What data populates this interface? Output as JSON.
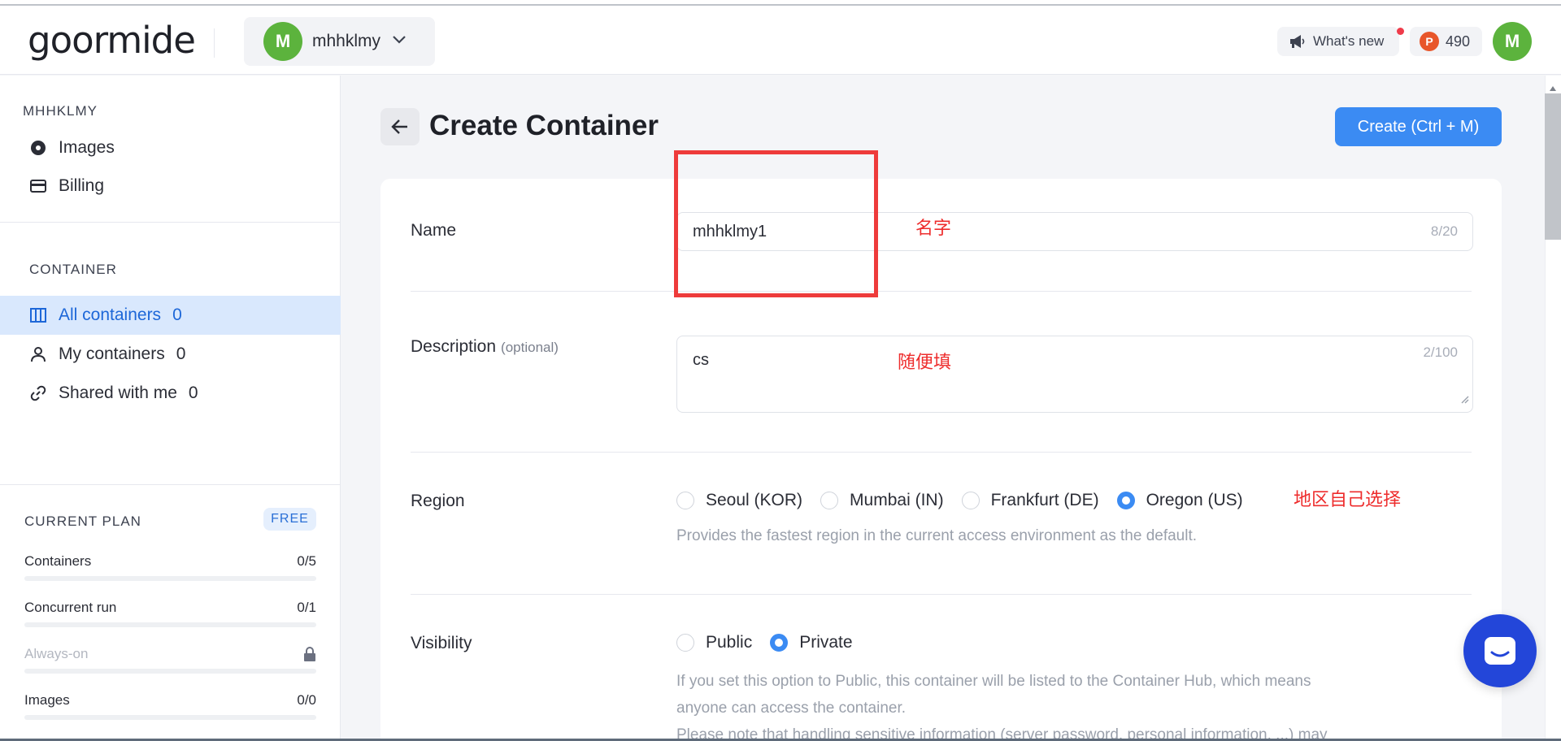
{
  "header": {
    "logo_text": "goormide",
    "workspace": {
      "avatar_letter": "M",
      "name": "mhhklmy"
    },
    "whats_new_label": "What's new",
    "points": {
      "badge": "P",
      "value": "490"
    },
    "user_avatar_letter": "M"
  },
  "sidebar": {
    "workspace_title": "MHHKLMY",
    "workspace_items": [
      {
        "label": "Images",
        "icon": "disc-icon"
      },
      {
        "label": "Billing",
        "icon": "card-icon"
      }
    ],
    "container_title": "CONTAINER",
    "container_items": [
      {
        "label": "All containers",
        "count": "0",
        "icon": "columns-icon",
        "active": true
      },
      {
        "label": "My containers",
        "count": "0",
        "icon": "person-icon"
      },
      {
        "label": "Shared with me",
        "count": "0",
        "icon": "link-icon"
      }
    ],
    "plan": {
      "title": "CURRENT PLAN",
      "badge": "FREE",
      "rows": [
        {
          "label": "Containers",
          "value": "0/5"
        },
        {
          "label": "Concurrent run",
          "value": "0/1"
        },
        {
          "label": "Always-on",
          "value": "",
          "locked": true
        },
        {
          "label": "Images",
          "value": "0/0"
        }
      ]
    }
  },
  "main": {
    "title": "Create Container",
    "create_button": "Create (Ctrl + M)",
    "form": {
      "name": {
        "label": "Name",
        "value": "mhhklmy1",
        "counter": "8/20"
      },
      "description": {
        "label": "Description",
        "optional": "(optional)",
        "value": "cs",
        "counter": "2/100"
      },
      "region": {
        "label": "Region",
        "options": [
          "Seoul (KOR)",
          "Mumbai (IN)",
          "Frankfurt (DE)",
          "Oregon (US)"
        ],
        "selected": "Oregon (US)",
        "help": "Provides the fastest region in the current access environment as the default."
      },
      "visibility": {
        "label": "Visibility",
        "options": [
          "Public",
          "Private"
        ],
        "selected": "Private",
        "help_line1": "If you set this option to Public, this container will be listed to the Container Hub, which means",
        "help_line2": "anyone can access the container.",
        "help_line3": "Please note that handling sensitive information (server password, personal information, ...) may"
      }
    }
  },
  "annotations": {
    "name_note": "名字",
    "description_note": "随便填",
    "region_note": "地区自己选择",
    "color": "#ee2d2d"
  },
  "colors": {
    "accent": "#3b8bf3",
    "avatar": "#5cb33d",
    "active_bg": "#d9e8fd",
    "chat": "#2346d9"
  }
}
